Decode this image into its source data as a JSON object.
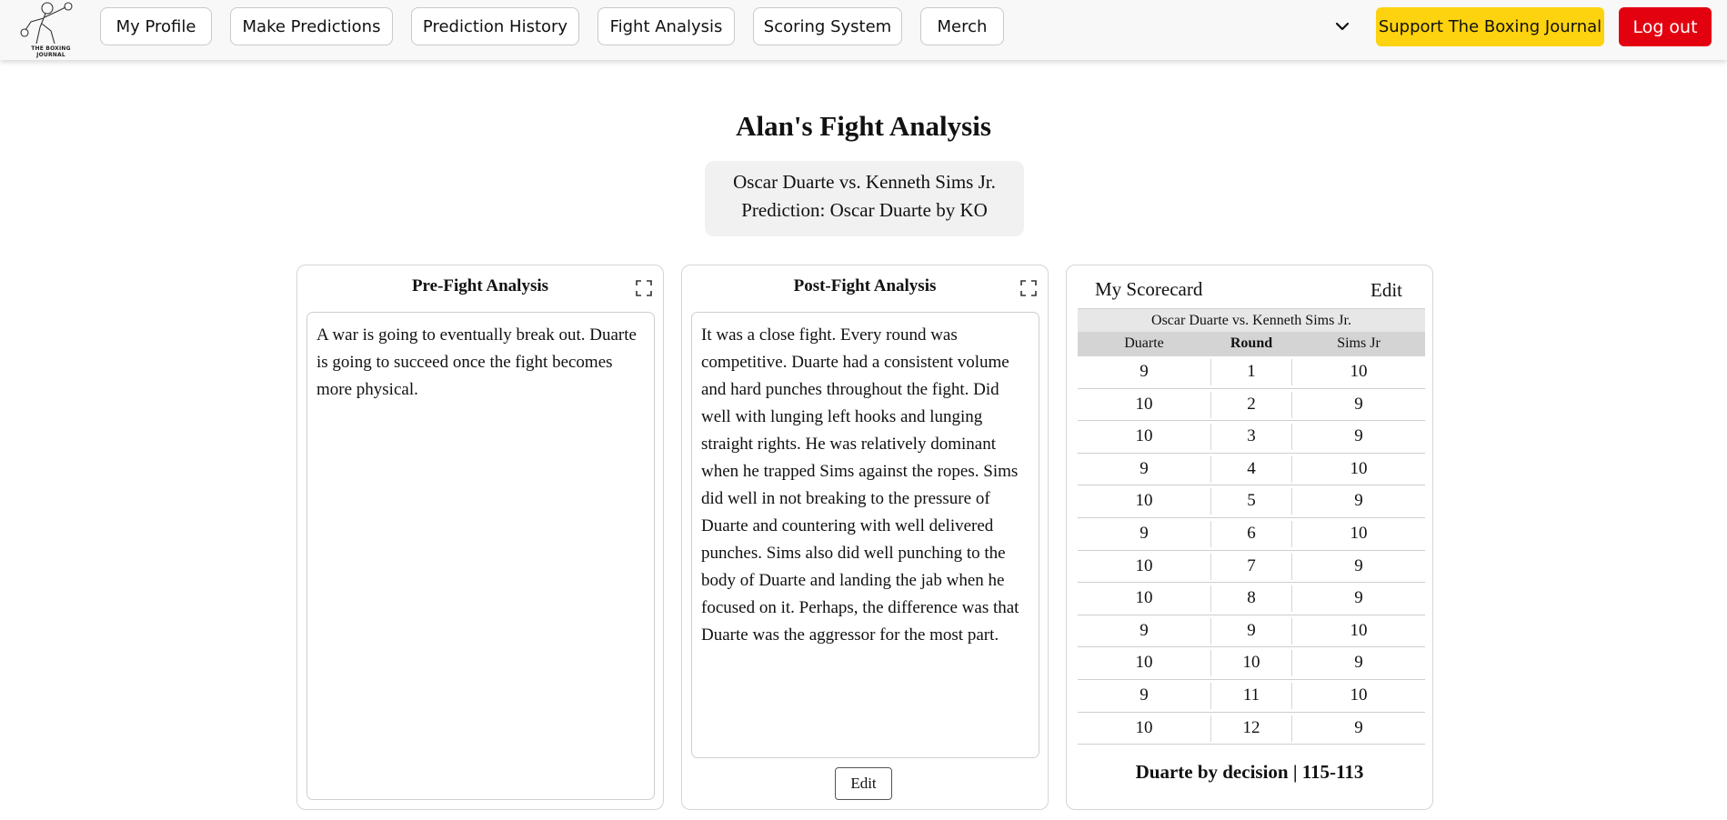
{
  "nav": {
    "logo_text": "THE BOXING JOURNAL",
    "items": [
      "My Profile",
      "Make Predictions",
      "Prediction History",
      "Fight Analysis",
      "Scoring System",
      "Merch"
    ],
    "support": "Support The Boxing Journal",
    "logout": "Log out",
    "support_color": "#fdd20e",
    "logout_color": "#e3000f"
  },
  "page": {
    "title": "Alan's Fight Analysis",
    "fight": "Oscar Duarte vs. Kenneth Sims Jr.",
    "prediction": "Prediction: Oscar Duarte by KO"
  },
  "pre": {
    "title": "Pre-Fight Analysis",
    "text": "A war is going to eventually break out. Duarte is going to succeed once the fight becomes more physical."
  },
  "post": {
    "title": "Post-Fight Analysis",
    "text": "It was a close fight. Every round was competitive. Duarte had a consistent volume and hard punches throughout the fight. Did well with lunging left hooks and lunging straight rights. He was relatively dominant when he trapped Sims against the ropes. Sims did well in not breaking to the pressure of Duarte and countering with well delivered punches. Sims also did well punching to the body of Duarte and landing the jab when he focused on it. Perhaps, the difference was that Duarte was the aggressor for the most part.",
    "edit": "Edit"
  },
  "scorecard": {
    "title": "My Scorecard",
    "edit": "Edit",
    "fight": "Oscar Duarte vs. Kenneth Sims Jr.",
    "headers": [
      "Duarte",
      "Round",
      "Sims Jr"
    ],
    "rows": [
      [
        "9",
        "1",
        "10"
      ],
      [
        "10",
        "2",
        "9"
      ],
      [
        "10",
        "3",
        "9"
      ],
      [
        "9",
        "4",
        "10"
      ],
      [
        "10",
        "5",
        "9"
      ],
      [
        "9",
        "6",
        "10"
      ],
      [
        "10",
        "7",
        "9"
      ],
      [
        "10",
        "8",
        "9"
      ],
      [
        "9",
        "9",
        "10"
      ],
      [
        "10",
        "10",
        "9"
      ],
      [
        "9",
        "11",
        "10"
      ],
      [
        "10",
        "12",
        "9"
      ]
    ],
    "result": "Duarte by decision | 115-113"
  }
}
